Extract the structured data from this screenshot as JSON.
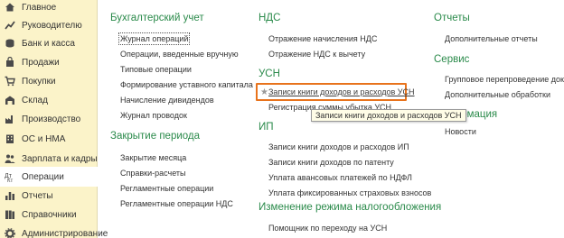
{
  "sidebar": {
    "items": [
      {
        "label": "Главное",
        "icon": "home-icon"
      },
      {
        "label": "Руководителю",
        "icon": "chart-trend-icon"
      },
      {
        "label": "Банк и касса",
        "icon": "coins-icon"
      },
      {
        "label": "Продажи",
        "icon": "shopping-bag-icon"
      },
      {
        "label": "Покупки",
        "icon": "cart-icon"
      },
      {
        "label": "Склад",
        "icon": "warehouse-icon"
      },
      {
        "label": "Производство",
        "icon": "factory-icon"
      },
      {
        "label": "ОС и НМА",
        "icon": "building-icon"
      },
      {
        "label": "Зарплата и кадры",
        "icon": "people-icon"
      },
      {
        "label": "Операции",
        "icon": "operations-icon",
        "active": true
      },
      {
        "label": "Отчеты",
        "icon": "bar-chart-icon"
      },
      {
        "label": "Справочники",
        "icon": "books-icon"
      },
      {
        "label": "Администрирование",
        "icon": "gear-icon"
      }
    ]
  },
  "content": {
    "col1": {
      "heading1": "Бухгалтерский учет",
      "links1": [
        "Журнал операций",
        "Операции, введенные вручную",
        "Типовые операции",
        "Формирование уставного капитала",
        "Начисление дивидендов",
        "Журнал проводок"
      ],
      "heading2": "Закрытие периода",
      "links2": [
        "Закрытие месяца",
        "Справки-расчеты",
        "Регламентные операции",
        "Регламентные операции НДС"
      ]
    },
    "col2": {
      "heading_nds": "НДС",
      "links_nds": [
        "Отражение начисления НДС",
        "Отражение НДС к вычету"
      ],
      "heading_usn": "УСН",
      "links_usn": [
        "Записи книги доходов и расходов УСН",
        "Регистрация суммы убытка УСН"
      ],
      "heading_ip": "ИП",
      "links_ip": [
        "Записи книги доходов и расходов ИП",
        "Записи книги доходов по патенту",
        "Уплата авансовых платежей по НДФЛ",
        "Уплата фиксированных страховых взносов"
      ],
      "heading_change": "Изменение режима налогообложения",
      "links_change": [
        "Помощник по переходу на УСН"
      ]
    },
    "col3": {
      "heading_reports": "Отчеты",
      "links_reports": [
        "Дополнительные отчеты"
      ],
      "heading_service": "Сервис",
      "links_service": [
        "Групповое перепроведение документ",
        "Дополнительные обработки"
      ],
      "heading_info": "нформация",
      "links_info": [
        "Новости"
      ]
    },
    "tooltip": "Записи книги доходов и расходов УСН",
    "highlight_color": "#e8731c"
  }
}
